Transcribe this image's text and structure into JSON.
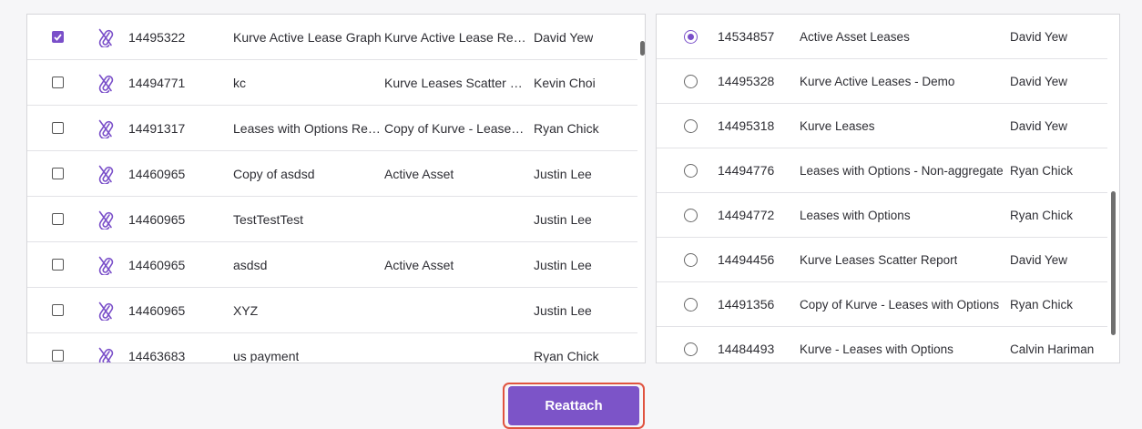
{
  "colors": {
    "accent": "#7c54c8",
    "highlight": "#e0533f"
  },
  "left_table": {
    "row_icon": "detach-paperclip-icon",
    "rows": [
      {
        "checked": true,
        "id": "14495322",
        "name": "Kurve Active Lease Graph",
        "report": "Kurve Active Lease Rep...",
        "owner": "David Yew"
      },
      {
        "checked": false,
        "id": "14494771",
        "name": "kc",
        "report": "Kurve Leases Scatter Re...",
        "owner": "Kevin Choi"
      },
      {
        "checked": false,
        "id": "14491317",
        "name": "Leases with Options Rep...",
        "report": "Copy of Kurve - Leases ...",
        "owner": "Ryan Chick"
      },
      {
        "checked": false,
        "id": "14460965",
        "name": "Copy of asdsd",
        "report": "Active Asset",
        "owner": "Justin Lee"
      },
      {
        "checked": false,
        "id": "14460965",
        "name": "TestTestTest",
        "report": "",
        "owner": "Justin Lee"
      },
      {
        "checked": false,
        "id": "14460965",
        "name": "asdsd",
        "report": "Active Asset",
        "owner": "Justin Lee"
      },
      {
        "checked": false,
        "id": "14460965",
        "name": "XYZ",
        "report": "",
        "owner": "Justin Lee"
      },
      {
        "checked": false,
        "id": "14463683",
        "name": "us payment",
        "report": "",
        "owner": "Ryan Chick"
      }
    ]
  },
  "right_table": {
    "rows": [
      {
        "selected": true,
        "id": "14534857",
        "name": "Active Asset Leases",
        "owner": "David Yew"
      },
      {
        "selected": false,
        "id": "14495328",
        "name": "Kurve Active Leases - Demo",
        "owner": "David Yew"
      },
      {
        "selected": false,
        "id": "14495318",
        "name": "Kurve Leases",
        "owner": "David Yew"
      },
      {
        "selected": false,
        "id": "14494776",
        "name": "Leases with Options - Non-aggregate",
        "owner": "Ryan Chick"
      },
      {
        "selected": false,
        "id": "14494772",
        "name": "Leases with Options",
        "owner": "Ryan Chick"
      },
      {
        "selected": false,
        "id": "14494456",
        "name": "Kurve Leases Scatter Report",
        "owner": "David Yew"
      },
      {
        "selected": false,
        "id": "14491356",
        "name": "Copy of Kurve - Leases with Options",
        "owner": "Ryan Chick"
      },
      {
        "selected": false,
        "id": "14484493",
        "name": "Kurve - Leases with Options",
        "owner": "Calvin Hariman"
      }
    ]
  },
  "actions": {
    "reattach_label": "Reattach"
  }
}
